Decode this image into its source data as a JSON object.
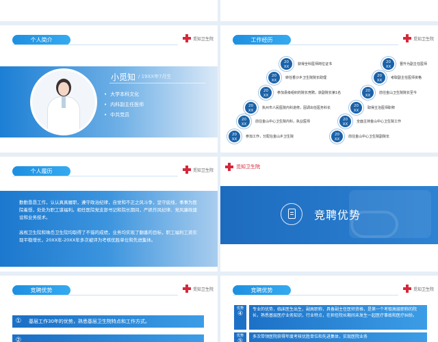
{
  "slide_profile": {
    "section": "个人简介",
    "logo": "觅知卫生院",
    "name": "小觅知",
    "born": "/ 19XX年7月生",
    "items": [
      "大学本科文化",
      "内科副主任医师",
      "中共党员"
    ]
  },
  "slide_timeline": {
    "section": "工作经历",
    "logo": "觅知卫生院",
    "year_label": "20\nXX",
    "left_items": [
      "获得全科医师岗位证书",
      "转任香沙乡卫生院院长助理",
      "参加县级组织的院长竞聘，获副院长第1名",
      "执州市人民医院内科进修，因调出任医务科长",
      "前往金山中心卫生院内科，执业医师",
      "参加工作，分配在金山乡卫生院"
    ],
    "right_items": [
      "晋升为副主任医师",
      "考取副主任医师资格",
      "前往金山卫生院院长至今",
      "取得主治医师职称",
      "全面主持金山中心卫生院工作",
      "前往金山中心卫生院副院长"
    ]
  },
  "slide_resume": {
    "section": "个人履历",
    "logo": "觅知卫生院",
    "paragraphs": [
      "勤勤恳恳工作，认认真真履职，遵守政治纪律，自觉和不正之风斗争，坚守底线，事事为医院着想，处处为职工谋福利。相任医院党支部书记和院长期间，严抓作风纪律、党风廉政建设和业务技术。",
      "高枧卫生院和珠岙卫生院均取得了不错的成绩，业务均实现了翻番的目标，职工福利工资实现平稳增长，20XX年-20XX年多次被评为考核优胜单位和先进集体。"
    ]
  },
  "slide_title": {
    "logo": "觅知卫生院",
    "title": "竞聘优势"
  },
  "slide_adv_left": {
    "section": "竞聘优势",
    "logo": "觅知卫生院",
    "rows": [
      {
        "num": "①",
        "text": "基层工作30年的优势，熟悉基层卫生院特点和工作方式。"
      },
      {
        "num": "②",
        "text": ""
      }
    ]
  },
  "slide_adv_right": {
    "section": "竞聘优势",
    "logo": "觅知卫生院",
    "rows": [
      {
        "tag": "优势",
        "num": "④",
        "text": "专业的优势，临床医生出生，副高职称，具备副主任医师资格，是第一个考取高级职称的院长，熟悉基层医疗业务知识，行业特点，在担任院长期间未发生一起医疗事故和医疗纠纷。"
      },
      {
        "tag": "优势",
        "num": "⑤",
        "text": "多次带领医院获得年度考核优胜单位和先进集体，实现医院业务"
      }
    ]
  },
  "colors": {
    "primary": "#1c71c6",
    "accent": "#35aaf0",
    "logo_red": "#d6273a",
    "background": "#e6eef6"
  },
  "icons": [
    "medical-cross-icon",
    "clipboard-icon",
    "doctor-photo"
  ]
}
